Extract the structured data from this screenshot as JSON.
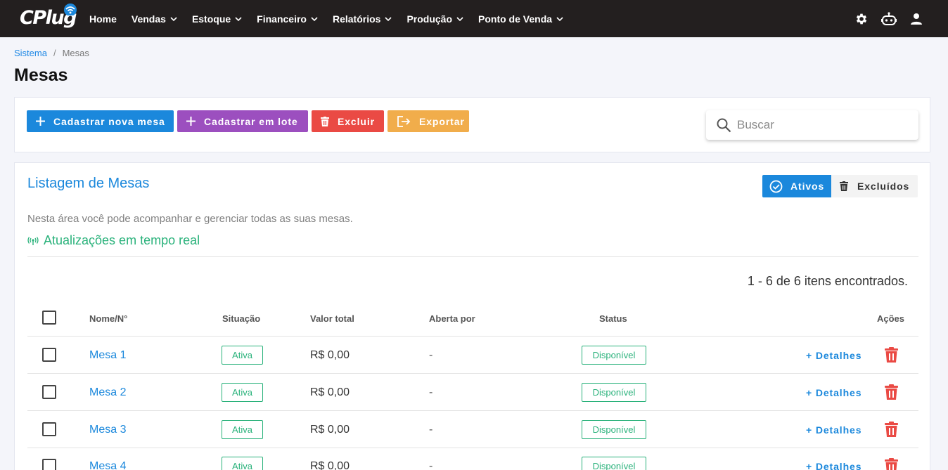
{
  "navbar": {
    "logo_text": "CPlug",
    "menu": [
      {
        "label": "Home",
        "dropdown": false
      },
      {
        "label": "Vendas",
        "dropdown": true
      },
      {
        "label": "Estoque",
        "dropdown": true
      },
      {
        "label": "Financeiro",
        "dropdown": true
      },
      {
        "label": "Relatórios",
        "dropdown": true
      },
      {
        "label": "Produção",
        "dropdown": true
      },
      {
        "label": "Ponto de Venda",
        "dropdown": true
      }
    ],
    "right_icons": [
      "gear-icon",
      "robot-icon",
      "user-icon"
    ]
  },
  "breadcrumb": {
    "root": "Sistema",
    "separator": "/",
    "current": "Mesas"
  },
  "page_title": "Mesas",
  "toolbar": {
    "new_label": "Cadastrar nova mesa",
    "batch_label": "Cadastrar em lote",
    "delete_label": "Excluir",
    "export_label": "Exportar",
    "search_placeholder": "Buscar"
  },
  "list": {
    "title": "Listagem de Mesas",
    "filter_active_label": "Ativos",
    "filter_deleted_label": "Excluídos",
    "description": "Nesta área você pode acompanhar e gerenciar todas as suas mesas.",
    "realtime_label": "Atualizações em tempo real",
    "count_text": "1 - 6 de 6 itens encontrados.",
    "columns": {
      "name": "Nome/N°",
      "situacao": "Situação",
      "valor": "Valor total",
      "aberta": "Aberta por",
      "status": "Status",
      "acoes": "Ações"
    },
    "details_label": "+ Detalhes",
    "rows": [
      {
        "name": "Mesa 1",
        "situacao": "Ativa",
        "valor": "R$ 0,00",
        "aberta": "-",
        "status": "Disponível"
      },
      {
        "name": "Mesa 2",
        "situacao": "Ativa",
        "valor": "R$ 0,00",
        "aberta": "-",
        "status": "Disponível"
      },
      {
        "name": "Mesa 3",
        "situacao": "Ativa",
        "valor": "R$ 0,00",
        "aberta": "-",
        "status": "Disponível"
      },
      {
        "name": "Mesa 4",
        "situacao": "Ativa",
        "valor": "R$ 0,00",
        "aberta": "-",
        "status": "Disponível"
      }
    ]
  },
  "colors": {
    "navbar": "#231f1f",
    "primary": "#1b88dc",
    "purple": "#9c4fbf",
    "danger": "#ea4a44",
    "warning": "#f1ad4b",
    "success": "#2ab27b"
  }
}
